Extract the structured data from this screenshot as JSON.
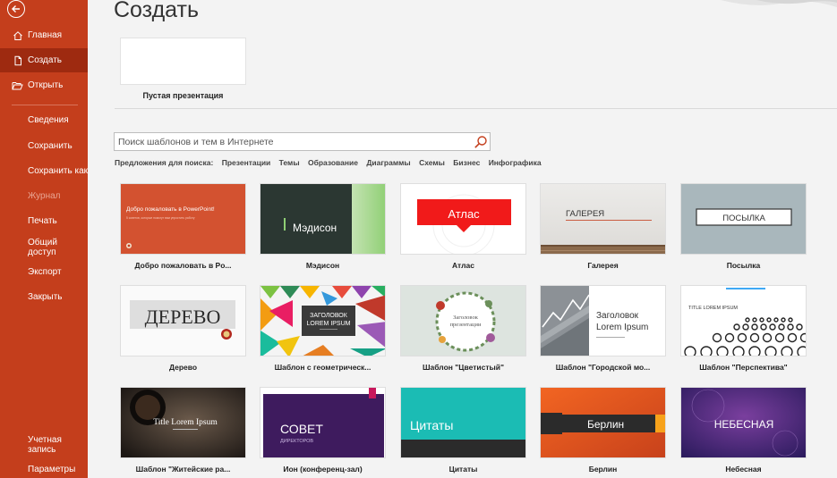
{
  "sidebar": {
    "items": [
      {
        "label": "Главная"
      },
      {
        "label": "Создать"
      },
      {
        "label": "Открыть"
      },
      {
        "label": "Сведения"
      },
      {
        "label": "Сохранить"
      },
      {
        "label": "Сохранить как"
      },
      {
        "label": "Журнал"
      },
      {
        "label": "Печать"
      },
      {
        "label": "Общий доступ"
      },
      {
        "label": "Экспорт"
      },
      {
        "label": "Закрыть"
      },
      {
        "label": "Учетная запись"
      },
      {
        "label": "Параметры"
      }
    ]
  },
  "main": {
    "title": "Создать",
    "blank_label": "Пустая презентация",
    "search_placeholder": "Поиск шаблонов и тем в Интернете",
    "suggestions_label": "Предложения для поиска:",
    "suggestions": [
      "Презентации",
      "Темы",
      "Образование",
      "Диаграммы",
      "Схемы",
      "Бизнес",
      "Инфографика"
    ]
  },
  "templates": [
    {
      "label": "Добро пожаловать в Po...",
      "thumb_title": "Добро пожаловать в PowerPoint!",
      "thumb_sub": "5 советов, которые помогут вам упростить работу"
    },
    {
      "label": "Мэдисон",
      "thumb_title": "Мэдисон"
    },
    {
      "label": "Атлас",
      "thumb_title": "Атлас"
    },
    {
      "label": "Галерея",
      "thumb_title": "ГАЛЕРЕЯ"
    },
    {
      "label": "Посылка",
      "thumb_title": "ПОСЫЛКА"
    },
    {
      "label": "Дерево",
      "thumb_title": "ДЕРЕВО"
    },
    {
      "label": "Шаблон с геометрическ...",
      "thumb_title": "ЗАГОЛОВОК",
      "thumb_sub": "LOREM IPSUM"
    },
    {
      "label": "Шаблон \"Цветистый\"",
      "thumb_title": "Заголовок",
      "thumb_sub": "презентации"
    },
    {
      "label": "Шаблон \"Городской мо...",
      "thumb_title": "Заголовок",
      "thumb_sub": "Lorem Ipsum"
    },
    {
      "label": "Шаблон \"Перспектива\"",
      "thumb_title": "TITLE LOREM IPSUM"
    },
    {
      "label": "Шаблон \"Житейские ра...",
      "thumb_title": "Title Lorem Ipsum"
    },
    {
      "label": "Ион (конференц-зал)",
      "thumb_title": "СОВЕТ",
      "thumb_sub": "ДИРЕКТОРОВ"
    },
    {
      "label": "Цитаты",
      "thumb_title": "Цитаты"
    },
    {
      "label": "Берлин",
      "thumb_title": "Берлин"
    },
    {
      "label": "Небесная",
      "thumb_title": "НЕБЕСНАЯ"
    }
  ]
}
